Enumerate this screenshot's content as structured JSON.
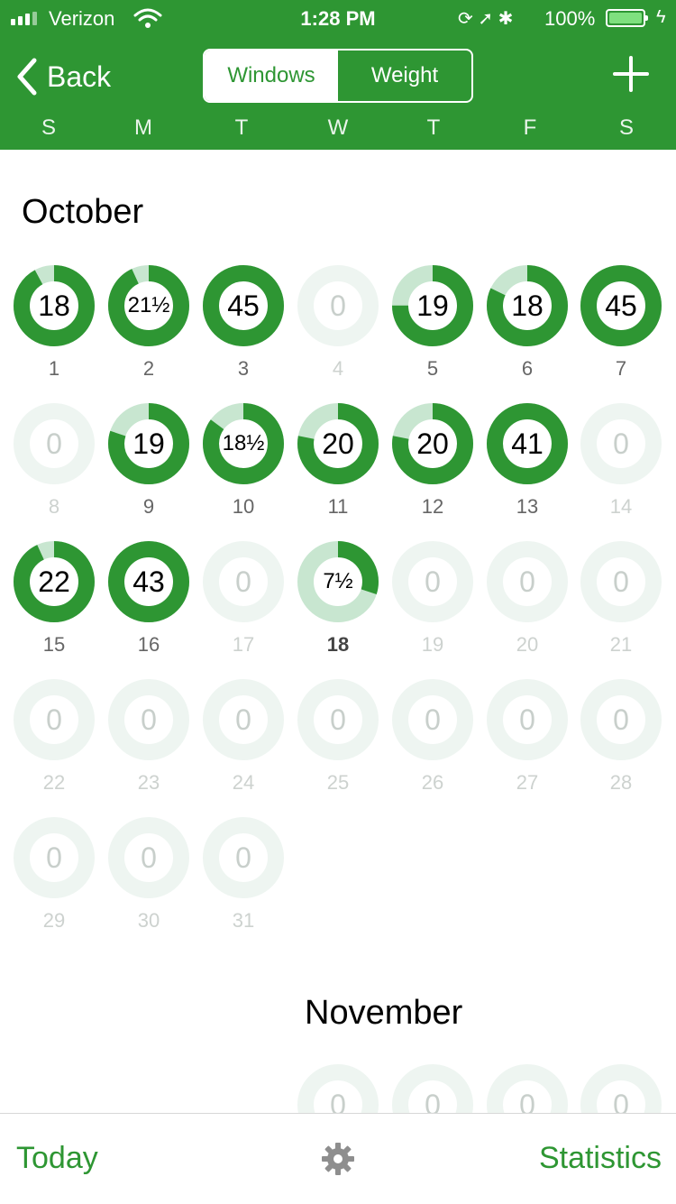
{
  "status_bar": {
    "carrier": "Verizon",
    "time": "1:28 PM",
    "battery": "100%"
  },
  "nav": {
    "back_label": "Back",
    "segments": [
      "Windows",
      "Weight"
    ],
    "active_segment": "Windows",
    "add_icon": "plus-icon"
  },
  "weekdays": [
    "S",
    "M",
    "T",
    "W",
    "T",
    "F",
    "S"
  ],
  "colors": {
    "brand_green": "#2e9633",
    "ring_track_light": "#c8e6d0",
    "ring_track_empty": "#eef5f1"
  },
  "months": [
    {
      "name": "October",
      "today": "18",
      "days": [
        {
          "day": "1",
          "value": "18",
          "progress": 0.92,
          "state": "past"
        },
        {
          "day": "2",
          "value": "21½",
          "progress": 0.93,
          "state": "past"
        },
        {
          "day": "3",
          "value": "45",
          "progress": 1.0,
          "state": "past"
        },
        {
          "day": "4",
          "value": "0",
          "progress": 0,
          "state": "future"
        },
        {
          "day": "5",
          "value": "19",
          "progress": 0.75,
          "state": "past"
        },
        {
          "day": "6",
          "value": "18",
          "progress": 0.82,
          "state": "past"
        },
        {
          "day": "7",
          "value": "45",
          "progress": 1.0,
          "state": "past"
        },
        {
          "day": "8",
          "value": "0",
          "progress": 0,
          "state": "future"
        },
        {
          "day": "9",
          "value": "19",
          "progress": 0.8,
          "state": "past"
        },
        {
          "day": "10",
          "value": "18½",
          "progress": 0.85,
          "state": "past"
        },
        {
          "day": "11",
          "value": "20",
          "progress": 0.78,
          "state": "past"
        },
        {
          "day": "12",
          "value": "20",
          "progress": 0.78,
          "state": "past"
        },
        {
          "day": "13",
          "value": "41",
          "progress": 1.0,
          "state": "past"
        },
        {
          "day": "14",
          "value": "0",
          "progress": 0,
          "state": "future"
        },
        {
          "day": "15",
          "value": "22",
          "progress": 0.93,
          "state": "past"
        },
        {
          "day": "16",
          "value": "43",
          "progress": 1.0,
          "state": "past"
        },
        {
          "day": "17",
          "value": "0",
          "progress": 0,
          "state": "future"
        },
        {
          "day": "18",
          "value": "7½",
          "progress": 0.3,
          "state": "today"
        },
        {
          "day": "19",
          "value": "0",
          "progress": 0,
          "state": "future"
        },
        {
          "day": "20",
          "value": "0",
          "progress": 0,
          "state": "future"
        },
        {
          "day": "21",
          "value": "0",
          "progress": 0,
          "state": "future"
        },
        {
          "day": "22",
          "value": "0",
          "progress": 0,
          "state": "future"
        },
        {
          "day": "23",
          "value": "0",
          "progress": 0,
          "state": "future"
        },
        {
          "day": "24",
          "value": "0",
          "progress": 0,
          "state": "future"
        },
        {
          "day": "25",
          "value": "0",
          "progress": 0,
          "state": "future"
        },
        {
          "day": "26",
          "value": "0",
          "progress": 0,
          "state": "future"
        },
        {
          "day": "27",
          "value": "0",
          "progress": 0,
          "state": "future"
        },
        {
          "day": "28",
          "value": "0",
          "progress": 0,
          "state": "future"
        },
        {
          "day": "29",
          "value": "0",
          "progress": 0,
          "state": "future"
        },
        {
          "day": "30",
          "value": "0",
          "progress": 0,
          "state": "future"
        },
        {
          "day": "31",
          "value": "0",
          "progress": 0,
          "state": "future"
        }
      ]
    },
    {
      "name": "November",
      "visible_values": [
        "0",
        "0",
        "0",
        "0"
      ]
    }
  ],
  "tab_bar": {
    "today_label": "Today",
    "settings_icon": "gear-icon",
    "statistics_label": "Statistics"
  }
}
